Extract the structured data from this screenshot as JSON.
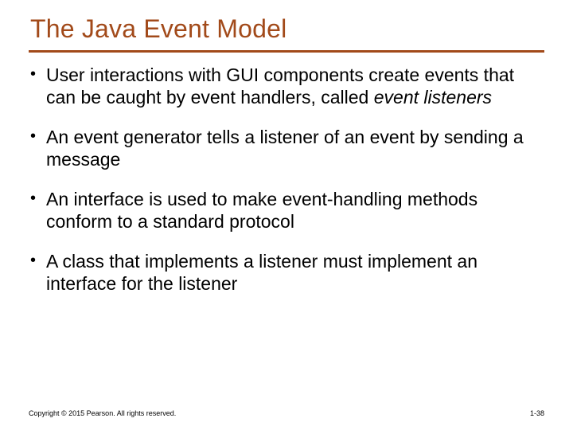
{
  "title": "The Java Event Model",
  "bullets": [
    {
      "pre": "User interactions with GUI components create events that can be caught by event handlers, called ",
      "em": "event listeners",
      "post": ""
    },
    {
      "pre": "An event generator tells a listener of an event by sending a message",
      "em": "",
      "post": ""
    },
    {
      "pre": "An interface is used to make event-handling methods conform to a standard protocol",
      "em": "",
      "post": ""
    },
    {
      "pre": "A class that implements a listener must implement an interface for the listener",
      "em": "",
      "post": ""
    }
  ],
  "footer": "Copyright © 2015 Pearson. All rights reserved.",
  "pagenum": "1-38"
}
